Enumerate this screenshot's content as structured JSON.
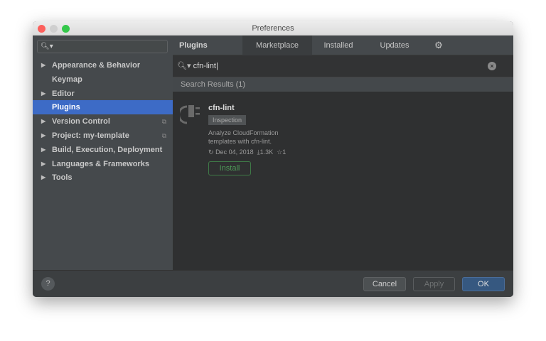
{
  "window": {
    "title": "Preferences"
  },
  "sidebar": {
    "search_placeholder": "",
    "items": [
      {
        "label": "Appearance & Behavior",
        "arrow": "▶"
      },
      {
        "label": "Keymap"
      },
      {
        "label": "Editor",
        "arrow": "▶"
      },
      {
        "label": "Plugins",
        "selected": true
      },
      {
        "label": "Version Control",
        "arrow": "▶",
        "copy": "⧉"
      },
      {
        "label": "Project: my-template",
        "arrow": "▶",
        "copy": "⧉"
      },
      {
        "label": "Build, Execution, Deployment",
        "arrow": "▶"
      },
      {
        "label": "Languages & Frameworks",
        "arrow": "▶"
      },
      {
        "label": "Tools",
        "arrow": "▶"
      }
    ]
  },
  "tabs": {
    "header": "Plugins",
    "items": [
      "Marketplace",
      "Installed",
      "Updates"
    ]
  },
  "search": {
    "value": "cfn-lint"
  },
  "results": {
    "header": "Search Results (1)",
    "plugin": {
      "name": "cfn-lint",
      "tag": "Inspection",
      "desc_line1": "Analyze CloudFormation",
      "desc_line2": "templates with cfn-lint.",
      "date": "Dec 04, 2018",
      "downloads": "1.3K",
      "rating": "1",
      "install": "Install"
    }
  },
  "footer": {
    "help": "?",
    "cancel": "Cancel",
    "apply": "Apply",
    "ok": "OK"
  },
  "colors": {
    "selection": "#3d6bc6",
    "ok": "#365880",
    "install": "#499c54"
  }
}
